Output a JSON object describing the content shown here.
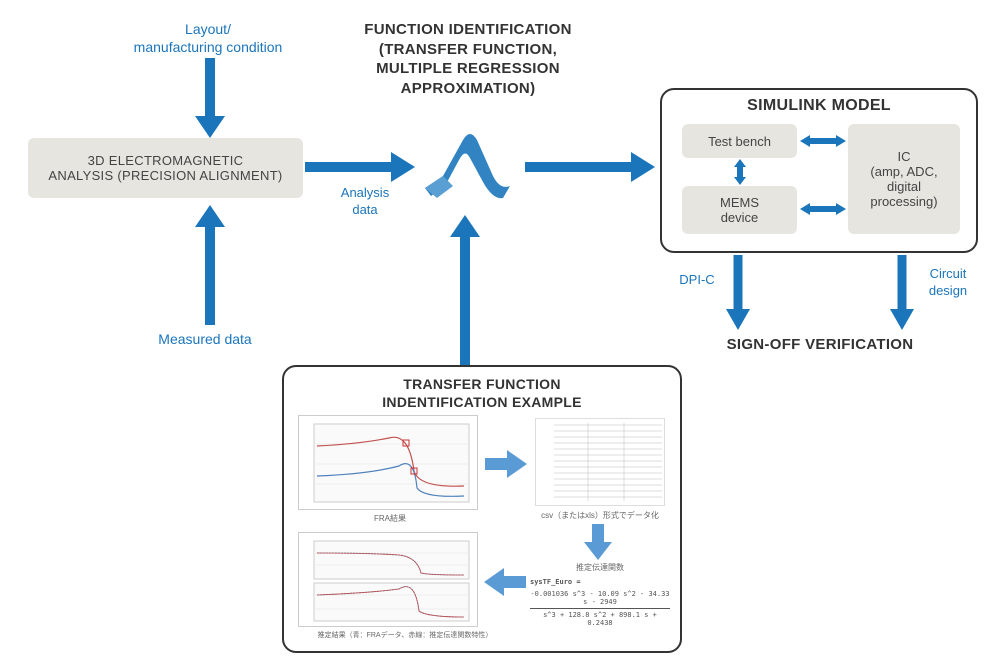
{
  "inputs": {
    "layout": "Layout/\nmanufacturing condition",
    "measured": "Measured data"
  },
  "blocks": {
    "analysis3d": "3D ELECTROMAGNETIC\nANALYSIS (PRECISION ALIGNMENT)",
    "analysis_data": "Analysis\ndata",
    "function_id_heading": "FUNCTION IDENTIFICATION\n(TRANSFER FUNCTION,\nMULTIPLE REGRESSION\nAPPROXIMATION)"
  },
  "simulink": {
    "heading": "SIMULINK MODEL",
    "test_bench": "Test bench",
    "mems": "MEMS\ndevice",
    "ic": "IC\n(amp, ADC,\ndigital\nprocessing)",
    "dpi_c": "DPI-C",
    "circuit": "Circuit\ndesign"
  },
  "signoff": "SIGN-OFF VERIFICATION",
  "example": {
    "heading": "TRANSFER FUNCTION\nINDENTIFICATION EXAMPLE",
    "fra": "FRA結果",
    "csv": "csv（またはxls）形式でデータ化",
    "transfer_fn": "推定伝達関数",
    "result": "推定結果（青：FRAデータ、赤線：推定伝達関数特性）",
    "formula1": "sysTF_Euro =",
    "formula2": "-0.001036 s^3 - 10.09 s^2 - 34.33 s - 2949",
    "formula3": "s^3 + 128.8 s^2 + 898.1 s + 0.2438"
  }
}
